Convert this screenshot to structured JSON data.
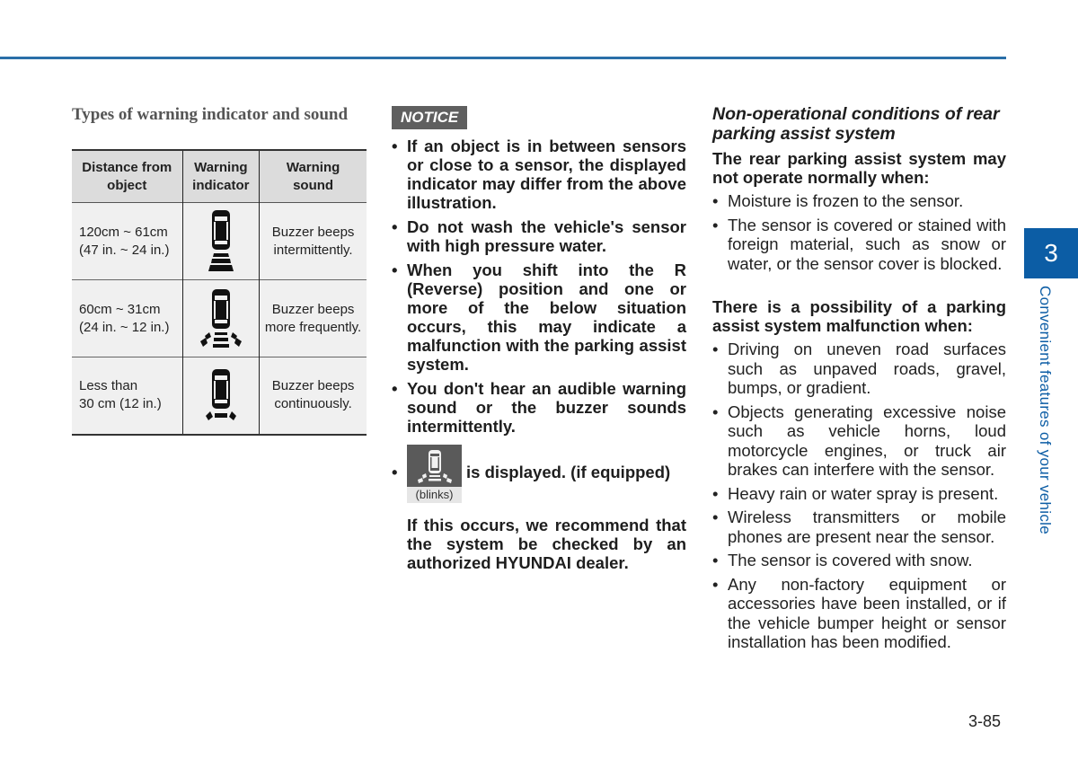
{
  "page": {
    "page_number": "3-85",
    "chapter_number": "3",
    "chapter_title": "Convenient features of your vehicle",
    "accent_color": "#0c5da5"
  },
  "warning_section": {
    "title": "Types of warning indicator and sound",
    "table": {
      "headers": [
        "Distance from object",
        "Warning indicator",
        "Warning sound"
      ],
      "rows": [
        {
          "distance_line1": "120cm ~ 61cm",
          "distance_line2": "(47 in. ~ 24 in.)",
          "indicator_icon": "car-rear-sensor-far-icon",
          "sound_line1": "Buzzer beeps",
          "sound_line2": "intermittently."
        },
        {
          "distance_line1": "60cm ~ 31cm",
          "distance_line2": "(24 in. ~ 12 in.)",
          "indicator_icon": "car-rear-sensor-mid-icon",
          "sound_line1": "Buzzer beeps",
          "sound_line2": "more frequently."
        },
        {
          "distance_line1": "Less than",
          "distance_line2": "30 cm (12 in.)",
          "indicator_icon": "car-rear-sensor-near-icon",
          "sound_line1": "Buzzer beeps",
          "sound_line2": "continuously."
        }
      ]
    }
  },
  "notice": {
    "label": "NOTICE",
    "items": [
      "If an object is in between sensors or close to a sensor, the displayed indicator may differ from the above illustration.",
      "Do not wash the vehicle's sensor with high pressure water.",
      "When you shift into the R (Reverse) position and one or more of the below situation occurs, this may indicate a malfunction with the parking assist system.",
      "You don't hear an audible warning sound or the buzzer sounds intermittently."
    ],
    "icon_item": {
      "icon": "parking-assist-malfunction-icon",
      "caption": "(blinks)",
      "text": "is displayed. (if equipped)"
    },
    "recommendation": "If this occurs, we recommend that the system be checked by an authorized HYUNDAI dealer."
  },
  "non_operational": {
    "title": "Non-operational conditions of rear parking assist system",
    "subheading1": "The rear parking assist system may not operate normally when:",
    "list1": [
      "Moisture is frozen to the sensor.",
      "The sensor is covered or stained with foreign material, such as snow or water, or the sensor cover is blocked."
    ],
    "subheading2": "There is a possibility of a parking assist system malfunction when:",
    "list2": [
      "Driving on uneven road surfaces such as unpaved roads, gravel, bumps, or gradient.",
      "Objects generating excessive noise such as vehicle horns, loud motorcycle engines, or truck air brakes can interfere with the sensor.",
      "Heavy rain or water spray is present.",
      "Wireless transmitters or mobile phones are present near the sensor.",
      "The sensor is covered with snow.",
      "Any non-factory equipment or accessories have been installed, or if the vehicle bumper height or sensor installation has been modified."
    ]
  }
}
